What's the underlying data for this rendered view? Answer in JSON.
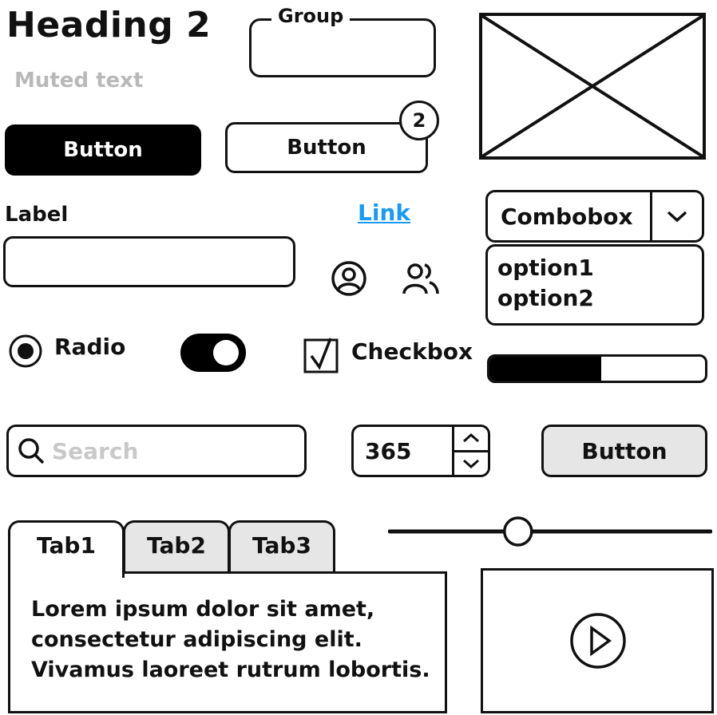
{
  "heading": "Heading 2",
  "muted_text": "Muted text",
  "group": {
    "label": "Group"
  },
  "buttons": {
    "primary": "Button",
    "secondary": "Button",
    "grey": "Button"
  },
  "badge": {
    "count": "2"
  },
  "form": {
    "label": "Label",
    "input_value": ""
  },
  "link": {
    "text": "Link",
    "color": "#1a9bf0"
  },
  "icons": {
    "user": "user-circle-icon",
    "users": "users-icon",
    "search": "search-icon",
    "play": "play-icon",
    "chevron": "chevron-down-icon"
  },
  "combobox": {
    "value": "Combobox",
    "options": [
      "option1",
      "option2"
    ]
  },
  "radio": {
    "label": "Radio",
    "checked": true
  },
  "toggle": {
    "on": true
  },
  "checkbox": {
    "label": "Checkbox",
    "checked": true
  },
  "progress": {
    "value": 0.52
  },
  "search": {
    "placeholder": "Search",
    "value": ""
  },
  "stepper": {
    "value": "365"
  },
  "tabs": [
    {
      "label": "Tab1",
      "active": true
    },
    {
      "label": "Tab2",
      "active": false
    },
    {
      "label": "Tab3",
      "active": false
    }
  ],
  "tab_content": [
    "Lorem ipsum dolor sit amet,",
    "consectetur adipiscing elit.",
    "Vivamus laoreet rutrum lobortis."
  ],
  "slider": {
    "value": 0.4
  }
}
